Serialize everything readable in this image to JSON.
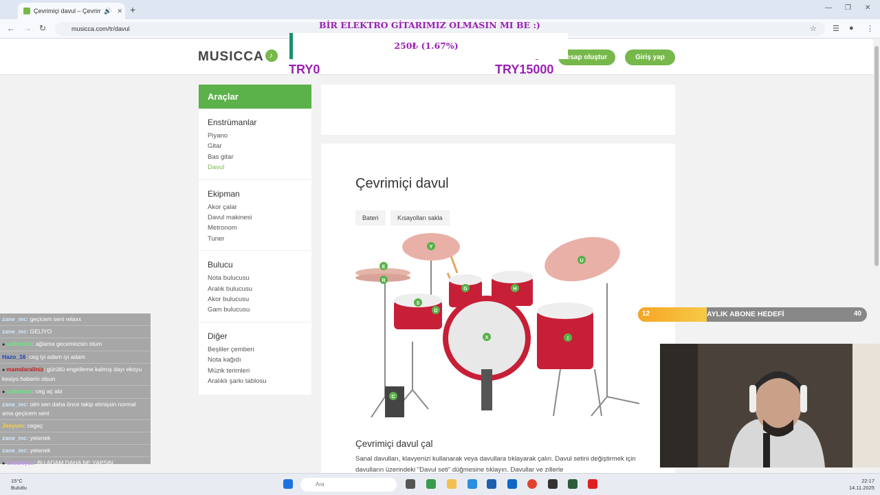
{
  "browser": {
    "tab_title": "Çevrimiçi davul – Çevrimiçi",
    "url": "musicca.com/tr/davul"
  },
  "site": {
    "logo": "MUSICCA",
    "signup_label": "esap oluştur",
    "login_label": "Giriş yap"
  },
  "sidebar": {
    "title": "Araçlar",
    "sections": [
      {
        "title": "Enstrümanlar",
        "items": [
          "Piyano",
          "Gitar",
          "Bas gitar",
          "Davul"
        ]
      },
      {
        "title": "Ekipman",
        "items": [
          "Akor çalar",
          "Davul makinesi",
          "Metronom",
          "Tuner"
        ]
      },
      {
        "title": "Bulucu",
        "items": [
          "Nota bulucusu",
          "Aralık bulucusu",
          "Akor bulucusu",
          "Gam bulucusu"
        ]
      },
      {
        "title": "Diğer",
        "items": [
          "Beşliler çemberi",
          "Nota kağıdı",
          "Müzik terimleri",
          "Aralıklı şarkı tablosu"
        ]
      }
    ]
  },
  "main": {
    "title": "Çevrimiçi davul",
    "chips": [
      "Bateri",
      "Kısayolları sakla"
    ],
    "subtitle": "Çevrimiçi davul çal",
    "description": "Sanal davulları, klavyenizi kullanarak veya davullara tıklayarak çalın. Davul setini değiştirmek için davulların üzerindeki \"Davul seti\" düğmesine tıklayın. Davullar ve zillerle"
  },
  "drum_keys": [
    "Y",
    "E",
    "R",
    "S",
    "D",
    "G",
    "H",
    "X",
    "U",
    "I",
    "C",
    "Y"
  ],
  "donation_goal": {
    "title": "BİR ELEKTRO GİTARIMIZ OLMASIN MI BE :)",
    "progress": "250₺ (1.67%)",
    "fraction": 0.0167,
    "min": "TRY0",
    "max": "TRY15000"
  },
  "chat": [
    {
      "user": "zane_mc",
      "msg": ": geçicem seni relaxx",
      "color": "#cfe8ff",
      "badge": false
    },
    {
      "user": "zane_mc",
      "msg": ": GELİYO",
      "color": "#cfe8ff",
      "badge": false
    },
    {
      "user": "saflsinizz",
      "msg": ": ağlama gecemezsin olum",
      "color": "#5cf07a",
      "badge": true
    },
    {
      "user": "Hazo_16",
      "msg": ": ceg iyi adam iyi adam",
      "color": "#1e3fbf",
      "badge": false
    },
    {
      "user": "mamdaraliniz",
      "msg": ": gürültü engelleme kalmış dayı ekoyu kesiyo haberin olsun",
      "color": "#c21c1c",
      "badge": true
    },
    {
      "user": "saflsinizz",
      "msg": ": ceg aç abi",
      "color": "#5cf07a",
      "badge": true
    },
    {
      "user": "zane_mc",
      "msg": ": olm sen daha önce takip etmişsin normal ama geçicem seni",
      "color": "#cfe8ff",
      "badge": false
    },
    {
      "user": "Jesyum",
      "msg": ": cegaç",
      "color": "#f5d23a",
      "badge": false
    },
    {
      "user": "zane_mc",
      "msg": ": yetenek",
      "color": "#cfe8ff",
      "badge": false
    },
    {
      "user": "zane_mc",
      "msg": ": yetenek",
      "color": "#cfe8ff",
      "badge": false
    },
    {
      "user": "CasBeyza",
      "msg": ": BU ADAM DAHA NE YAPSIN",
      "color": "#c79cff",
      "badge": true
    }
  ],
  "sub_goal": {
    "current": "12",
    "label": "AYLIK ABONE HEDEFİ",
    "target": "40",
    "fraction": 0.3
  },
  "taskbar": {
    "temp": "15°C",
    "weather": "Bulutlu",
    "search_placeholder": "Ara",
    "time": "22:17",
    "date": "14.11.2025"
  },
  "colors": {
    "brand_green": "#77b84b",
    "overlay_purple": "#9b1fb5"
  }
}
